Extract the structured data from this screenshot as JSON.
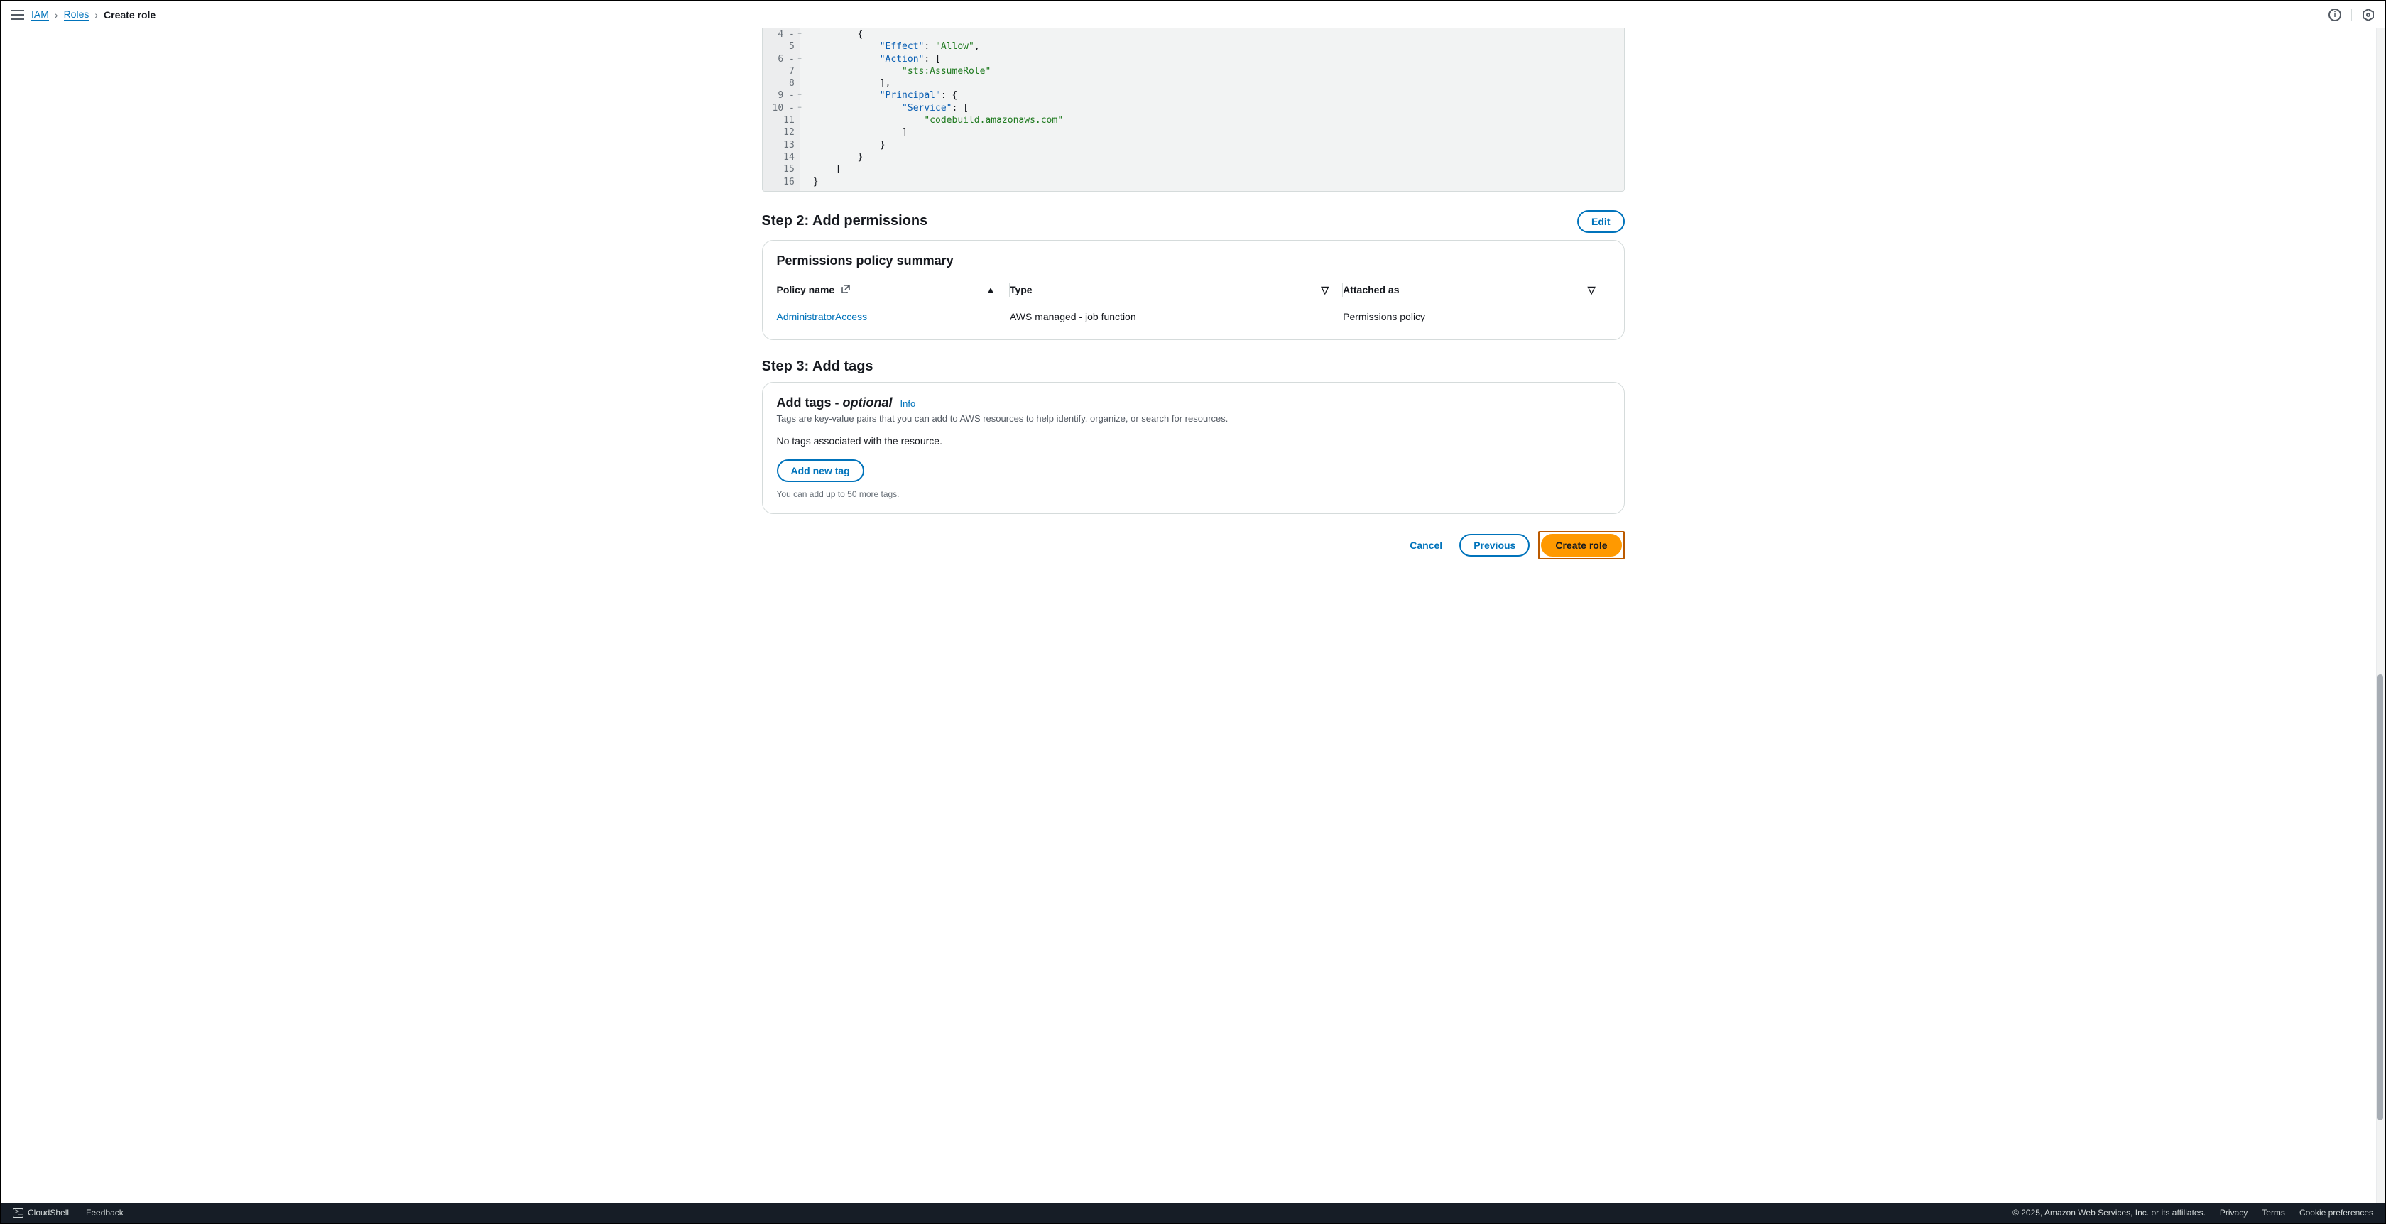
{
  "breadcrumbs": {
    "service": "IAM",
    "section": "Roles",
    "current": "Create role"
  },
  "code": {
    "lines": [
      {
        "n": 4,
        "fold": true,
        "indent": 3,
        "tokens": [
          {
            "t": "punc",
            "v": "{"
          }
        ]
      },
      {
        "n": 5,
        "fold": false,
        "indent": 4,
        "tokens": [
          {
            "t": "key",
            "v": "\"Effect\""
          },
          {
            "t": "punc",
            "v": ": "
          },
          {
            "t": "str",
            "v": "\"Allow\""
          },
          {
            "t": "punc",
            "v": ","
          }
        ]
      },
      {
        "n": 6,
        "fold": true,
        "indent": 4,
        "tokens": [
          {
            "t": "key",
            "v": "\"Action\""
          },
          {
            "t": "punc",
            "v": ": ["
          }
        ]
      },
      {
        "n": 7,
        "fold": false,
        "indent": 5,
        "tokens": [
          {
            "t": "str",
            "v": "\"sts:AssumeRole\""
          }
        ]
      },
      {
        "n": 8,
        "fold": false,
        "indent": 4,
        "tokens": [
          {
            "t": "punc",
            "v": "],"
          }
        ]
      },
      {
        "n": 9,
        "fold": true,
        "indent": 4,
        "tokens": [
          {
            "t": "key",
            "v": "\"Principal\""
          },
          {
            "t": "punc",
            "v": ": {"
          }
        ]
      },
      {
        "n": 10,
        "fold": true,
        "indent": 5,
        "tokens": [
          {
            "t": "key",
            "v": "\"Service\""
          },
          {
            "t": "punc",
            "v": ": ["
          }
        ]
      },
      {
        "n": 11,
        "fold": false,
        "indent": 6,
        "tokens": [
          {
            "t": "str",
            "v": "\"codebuild.amazonaws.com\""
          }
        ]
      },
      {
        "n": 12,
        "fold": false,
        "indent": 5,
        "tokens": [
          {
            "t": "punc",
            "v": "]"
          }
        ]
      },
      {
        "n": 13,
        "fold": false,
        "indent": 4,
        "tokens": [
          {
            "t": "punc",
            "v": "}"
          }
        ]
      },
      {
        "n": 14,
        "fold": false,
        "indent": 3,
        "tokens": [
          {
            "t": "punc",
            "v": "}"
          }
        ]
      },
      {
        "n": 15,
        "fold": false,
        "indent": 2,
        "tokens": [
          {
            "t": "punc",
            "v": "]"
          }
        ]
      },
      {
        "n": 16,
        "fold": false,
        "indent": 1,
        "tokens": [
          {
            "t": "punc",
            "v": "}"
          }
        ],
        "last": true
      }
    ]
  },
  "step2": {
    "heading": "Step 2: Add permissions",
    "edit": "Edit",
    "panel_title": "Permissions policy summary",
    "columns": {
      "name": "Policy name",
      "type": "Type",
      "attached": "Attached as"
    },
    "row": {
      "name": "AdministratorAccess",
      "type": "AWS managed - job function",
      "attached": "Permissions policy"
    }
  },
  "step3": {
    "heading": "Step 3: Add tags",
    "title_main": "Add tags - ",
    "title_optional": "optional",
    "info": "Info",
    "desc": "Tags are key-value pairs that you can add to AWS resources to help identify, organize, or search for resources.",
    "none": "No tags associated with the resource.",
    "add_btn": "Add new tag",
    "hint": "You can add up to 50 more tags."
  },
  "footer": {
    "cancel": "Cancel",
    "previous": "Previous",
    "create": "Create role"
  },
  "bottom": {
    "cloudshell": "CloudShell",
    "feedback": "Feedback",
    "copyright": "© 2025, Amazon Web Services, Inc. or its affiliates.",
    "privacy": "Privacy",
    "terms": "Terms",
    "cookies": "Cookie preferences"
  }
}
